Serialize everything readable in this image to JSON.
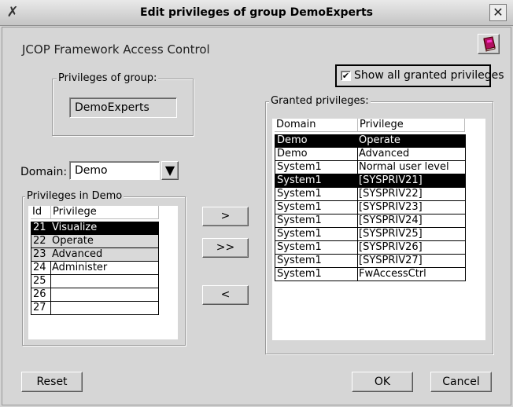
{
  "window": {
    "title": "Edit privileges of group DemoExperts",
    "close_symbol": "✕",
    "app_symbol": "✗"
  },
  "heading": "JCOP Framework Access Control",
  "help_icon": "book-icon",
  "group_box": {
    "legend": "Privileges of group:",
    "value": "DemoExperts"
  },
  "show_all": {
    "label": "Show all granted privileges",
    "checked": true,
    "check_mark": "✔"
  },
  "domain": {
    "label": "Domain:",
    "value": "Demo",
    "arrow": "▼"
  },
  "privileges_in_demo": {
    "legend": "Privileges in Demo",
    "columns": [
      "Id",
      "Privilege"
    ],
    "rows": [
      {
        "id": "21",
        "privilege": "Visualize",
        "state": "selected"
      },
      {
        "id": "22",
        "privilege": "Operate",
        "state": "grey"
      },
      {
        "id": "23",
        "privilege": "Advanced",
        "state": "grey"
      },
      {
        "id": "24",
        "privilege": "Administer",
        "state": "normal"
      },
      {
        "id": "25",
        "privilege": "",
        "state": "normal"
      },
      {
        "id": "26",
        "privilege": "",
        "state": "normal"
      },
      {
        "id": "27",
        "privilege": "",
        "state": "normal"
      }
    ]
  },
  "transfer_buttons": {
    "grant": ">",
    "grant_all": ">>",
    "revoke": "<"
  },
  "granted": {
    "legend": "Granted privileges:",
    "columns": [
      "Domain",
      "Privilege"
    ],
    "rows": [
      {
        "domain": "Demo",
        "privilege": "Operate",
        "state": "selected"
      },
      {
        "domain": "Demo",
        "privilege": "Advanced",
        "state": "normal"
      },
      {
        "domain": "System1",
        "privilege": "Normal user level",
        "state": "normal"
      },
      {
        "domain": "System1",
        "privilege": "[SYSPRIV21]",
        "state": "selected"
      },
      {
        "domain": "System1",
        "privilege": "[SYSPRIV22]",
        "state": "normal"
      },
      {
        "domain": "System1",
        "privilege": "[SYSPRIV23]",
        "state": "normal"
      },
      {
        "domain": "System1",
        "privilege": "[SYSPRIV24]",
        "state": "normal"
      },
      {
        "domain": "System1",
        "privilege": "[SYSPRIV25]",
        "state": "normal"
      },
      {
        "domain": "System1",
        "privilege": "[SYSPRIV26]",
        "state": "normal"
      },
      {
        "domain": "System1",
        "privilege": "[SYSPRIV27]",
        "state": "normal"
      },
      {
        "domain": "System1",
        "privilege": "FwAccessCtrl",
        "state": "normal"
      }
    ]
  },
  "footer": {
    "reset": "Reset",
    "ok": "OK",
    "cancel": "Cancel"
  }
}
